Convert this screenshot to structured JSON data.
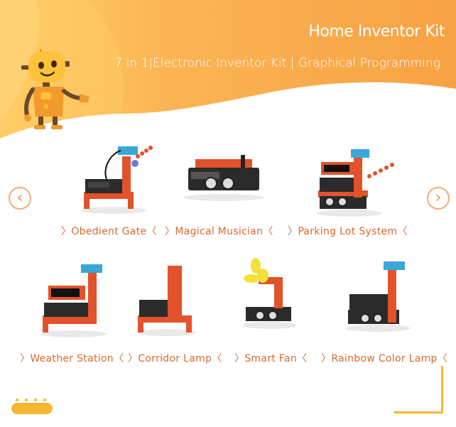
{
  "hero": {
    "title": "Home Inventor Kit",
    "subtitle": "7 in 1|Electronic Inventor Kit | Graphical Programming"
  },
  "carousel": {
    "prev_icon": "chevron-left-icon",
    "next_icon": "chevron-right-icon",
    "prev_glyph": "‹",
    "next_glyph": "›"
  },
  "products": [
    {
      "label": "Obedient Gate"
    },
    {
      "label": "Magical Musician"
    },
    {
      "label": "Parking Lot System"
    },
    {
      "label": "Weather Station"
    },
    {
      "label": "Corridor Lamp"
    },
    {
      "label": "Smart Fan"
    },
    {
      "label": "Rainbow Color Lamp"
    }
  ],
  "colors": {
    "accent": "#f6b731",
    "banner_orange": "#f9a84a",
    "label_orange": "#d9692f",
    "brick_red": "#e2522b"
  }
}
